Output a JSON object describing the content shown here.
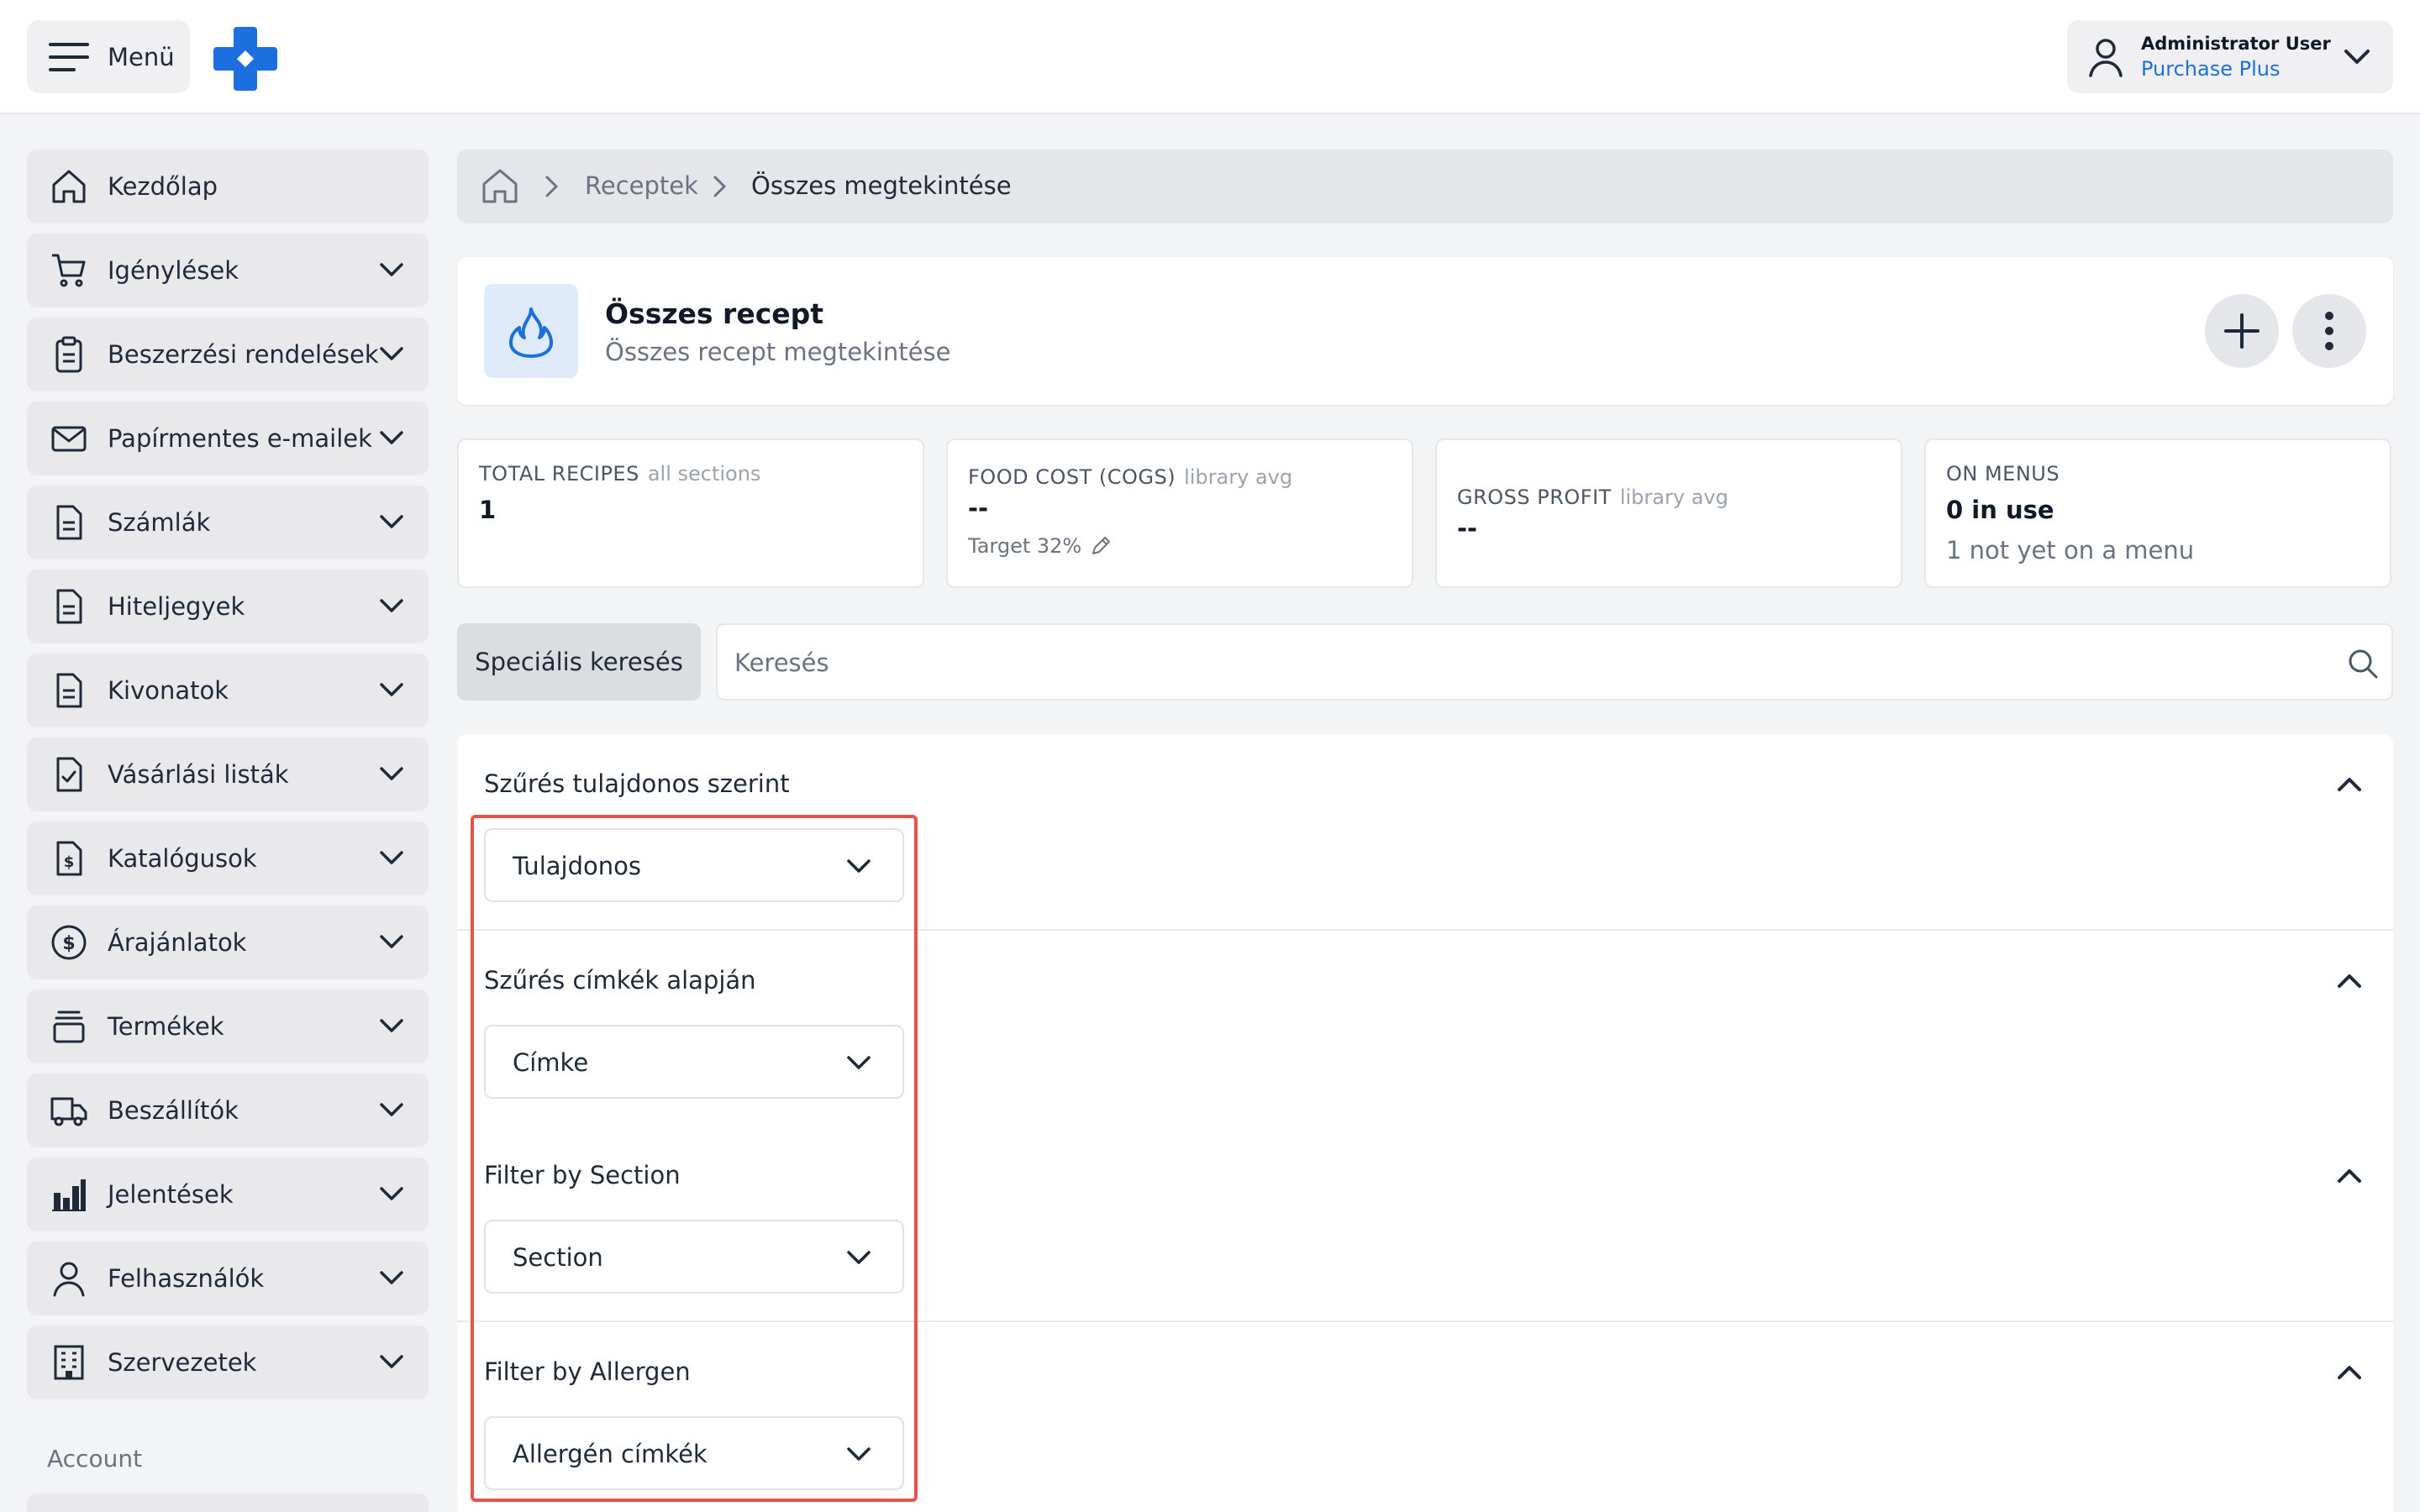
{
  "topbar": {
    "menu_label": "Menü",
    "user_name": "Administrator User",
    "user_org": "Purchase Plus",
    "brand_color": "#1d6fe0"
  },
  "sidebar": {
    "items": [
      {
        "label": "Kezdőlap",
        "icon": "home-icon",
        "expandable": false
      },
      {
        "label": "Igénylések",
        "icon": "cart-icon",
        "expandable": true
      },
      {
        "label": "Beszerzési rendelések",
        "icon": "clipboard-icon",
        "expandable": true
      },
      {
        "label": "Papírmentes e-mailek",
        "icon": "envelope-icon",
        "expandable": true
      },
      {
        "label": "Számlák",
        "icon": "document-icon",
        "expandable": true
      },
      {
        "label": "Hiteljegyek",
        "icon": "document-icon",
        "expandable": true
      },
      {
        "label": "Kivonatok",
        "icon": "document-icon",
        "expandable": true
      },
      {
        "label": "Vásárlási listák",
        "icon": "checklist-icon",
        "expandable": true
      },
      {
        "label": "Katalógusok",
        "icon": "dollar-document-icon",
        "expandable": true
      },
      {
        "label": "Árajánlatok",
        "icon": "dollar-circle-icon",
        "expandable": true
      },
      {
        "label": "Termékek",
        "icon": "stack-icon",
        "expandable": true
      },
      {
        "label": "Beszállítók",
        "icon": "truck-icon",
        "expandable": true
      },
      {
        "label": "Jelentések",
        "icon": "bar-chart-icon",
        "expandable": true
      },
      {
        "label": "Felhasználók",
        "icon": "user-icon",
        "expandable": true
      },
      {
        "label": "Szervezetek",
        "icon": "building-icon",
        "expandable": true
      }
    ],
    "section_label": "Account"
  },
  "breadcrumb": {
    "link": "Receptek",
    "current": "Összes megtekintése"
  },
  "header": {
    "title": "Összes recept",
    "subtitle": "Összes recept megtekintése"
  },
  "stats": {
    "total": {
      "label": "TOTAL RECIPES",
      "hint": "all sections",
      "value": "1"
    },
    "food_cost": {
      "label": "FOOD COST (COGS)",
      "hint": "library avg",
      "value": "--",
      "target": "Target 32%"
    },
    "gross_profit": {
      "label": "GROSS PROFIT",
      "hint": "library avg",
      "value": "--"
    },
    "on_menus": {
      "label": "ON MENUS",
      "value": "0 in use",
      "note": "1 not yet on a menu"
    }
  },
  "search": {
    "advanced_label": "Speciális keresés",
    "placeholder": "Keresés"
  },
  "filters": [
    {
      "title": "Szűrés tulajdonos szerint",
      "select": "Tulajdonos"
    },
    {
      "title": "Szűrés címkék alapján",
      "select": "Címke"
    },
    {
      "title": "Filter by Section",
      "select": "Section"
    },
    {
      "title": "Filter by Allergen",
      "select": "Allergén címkék"
    }
  ],
  "highlight_color": "#e5534b"
}
